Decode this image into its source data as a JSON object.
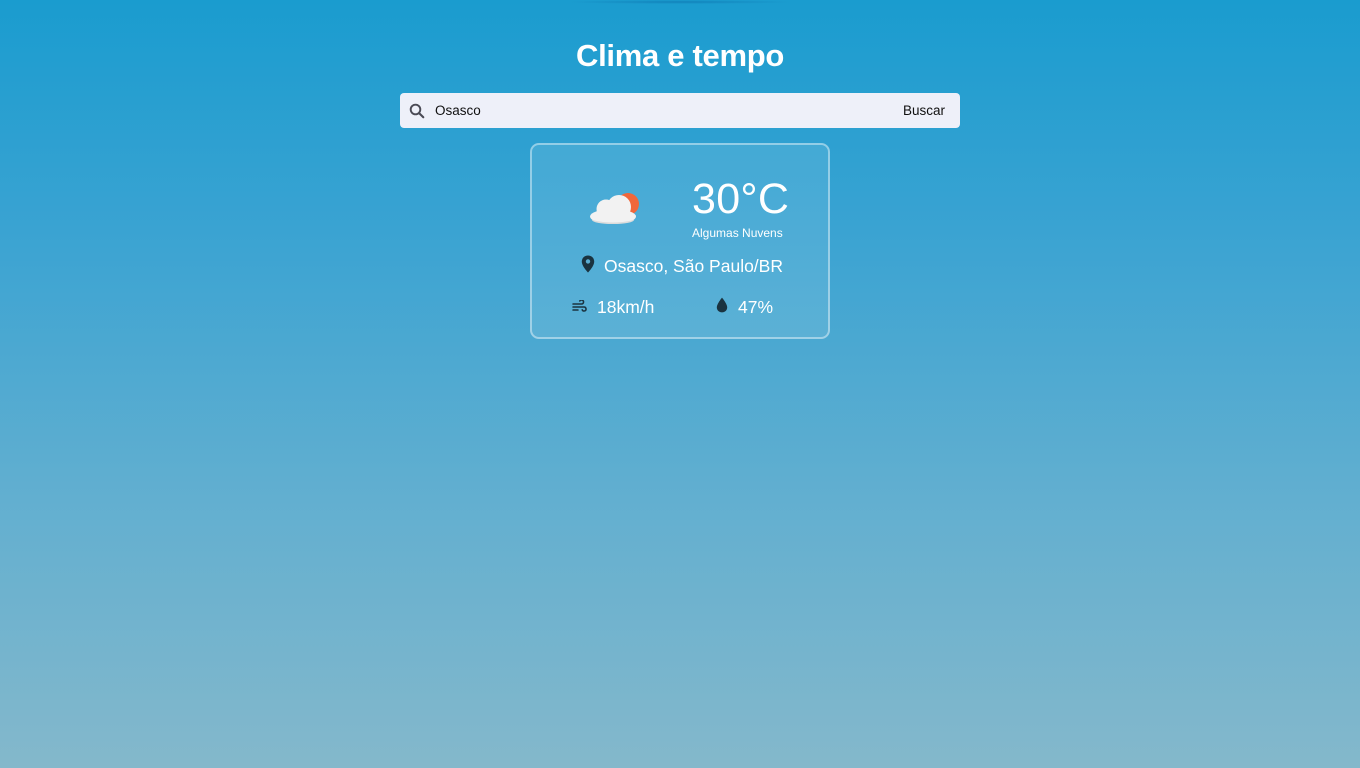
{
  "header": {
    "title": "Clima e tempo"
  },
  "search": {
    "value": "Osasco",
    "button_label": "Buscar",
    "icon": "search-icon"
  },
  "weather": {
    "icon": "partly-cloudy-icon",
    "temperature": "30°C",
    "condition": "Algumas Nuvens",
    "location_icon": "map-pin-icon",
    "location": "Osasco, São Paulo/BR",
    "wind_icon": "wind-icon",
    "wind": "18km/h",
    "humidity_icon": "water-drop-icon",
    "humidity": "47%"
  },
  "colors": {
    "background_top": "#1a9ccf",
    "background_bottom": "#84b8cb",
    "search_bg": "#eef0f9",
    "sun": "#f0673b",
    "icon_dark": "#1a3340"
  }
}
